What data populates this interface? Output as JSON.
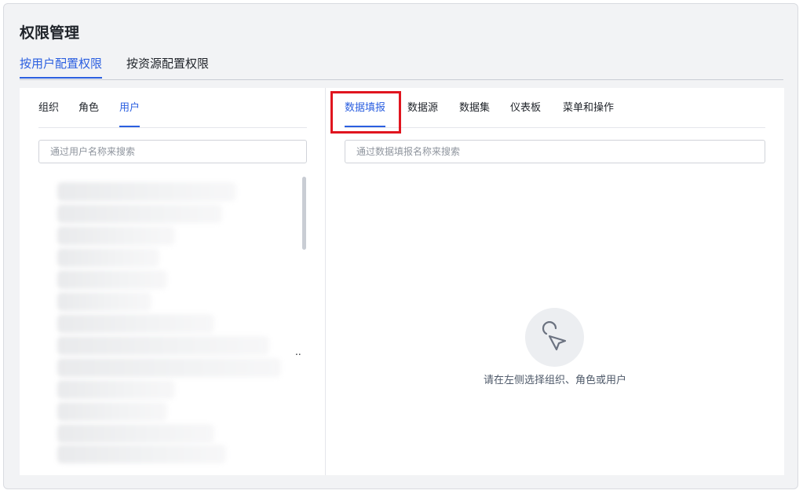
{
  "page": {
    "title": "权限管理"
  },
  "main_tabs": [
    {
      "label": "按用户配置权限",
      "active": true
    },
    {
      "label": "按资源配置权限",
      "active": false
    }
  ],
  "left_panel": {
    "tabs": [
      {
        "label": "组织",
        "active": false
      },
      {
        "label": "角色",
        "active": false
      },
      {
        "label": "用户",
        "active": true
      }
    ],
    "search_placeholder": "通过用户名称来搜索",
    "overflow_text": ".."
  },
  "right_panel": {
    "tabs": [
      {
        "label": "数据填报",
        "active": true
      },
      {
        "label": "数据源",
        "active": false
      },
      {
        "label": "数据集",
        "active": false
      },
      {
        "label": "仪表板",
        "active": false
      },
      {
        "label": "菜单和操作",
        "active": false
      }
    ],
    "search_placeholder": "通过数据填报名称来搜索",
    "empty_icon": "cursor-click-icon",
    "empty_text": "请在左侧选择组织、角色或用户"
  },
  "colors": {
    "accent": "#2b5fe0",
    "highlight": "#e0151f"
  }
}
